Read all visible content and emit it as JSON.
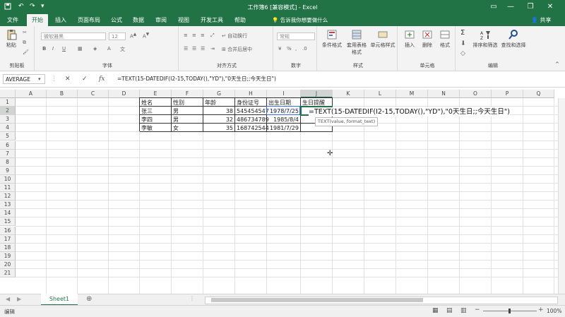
{
  "app": {
    "title": "工作簿6 [兼容模式] - Excel"
  },
  "tabs": [
    {
      "label": "文件"
    },
    {
      "label": "开始"
    },
    {
      "label": "插入"
    },
    {
      "label": "页面布局"
    },
    {
      "label": "公式"
    },
    {
      "label": "数据"
    },
    {
      "label": "审阅"
    },
    {
      "label": "视图"
    },
    {
      "label": "开发工具"
    },
    {
      "label": "帮助"
    }
  ],
  "tell_me": "告诉我你想要做什么",
  "share": "共享",
  "ribbon": {
    "clipboard": {
      "paste": "粘贴",
      "label": "剪贴板"
    },
    "font": {
      "name": "微软雅黑",
      "size": "12",
      "label": "字体"
    },
    "alignment": {
      "wrap": "自动换行",
      "merge": "合并后居中",
      "label": "对齐方式"
    },
    "number": {
      "format": "常规",
      "label": "数字"
    },
    "styles": {
      "conditional": "条件格式",
      "table": "套用表格格式",
      "cell": "单元格样式",
      "label": "样式"
    },
    "cells": {
      "insert": "插入",
      "delete": "删除",
      "format": "格式",
      "label": "单元格"
    },
    "editing": {
      "sort": "排序和筛选",
      "find": "查找和选择",
      "label": "编辑"
    }
  },
  "formula_bar": {
    "name_box": "AVERAGE",
    "formula": "=TEXT(15-DATEDIF(I2-15,TODAY(),\"YD\"),\"0天生日;;今天生日\")"
  },
  "columns": [
    "A",
    "B",
    "C",
    "D",
    "E",
    "F",
    "G",
    "H",
    "I",
    "J",
    "K",
    "L",
    "M",
    "N",
    "O",
    "P",
    "Q"
  ],
  "rows": [
    "1",
    "2",
    "3",
    "4",
    "5",
    "6",
    "7",
    "8",
    "9",
    "10",
    "11",
    "12",
    "13",
    "14",
    "15",
    "16",
    "17",
    "18",
    "19",
    "20",
    "21"
  ],
  "table": {
    "headers": [
      "姓名",
      "性别",
      "年龄",
      "身份证号",
      "出生日期",
      "生日提醒"
    ],
    "rows": [
      [
        "张三",
        "男",
        "38",
        "545454547",
        "1978/7/25",
        ""
      ],
      [
        "李四",
        "男",
        "32",
        "486734789",
        "1985/8/4",
        ""
      ],
      [
        "李敏",
        "女",
        "35",
        "168742544",
        "1981/7/29",
        ""
      ]
    ]
  },
  "edit_text": "=TEXT(15-DATEDIF(I2-15,TODAY(),\"YD\"),\"0天生日;;今天生日\")",
  "tooltip": "TEXT(value, format_text)",
  "sheet_tab": "Sheet1",
  "status": {
    "mode": "编辑",
    "zoom": "100%"
  },
  "colors": {
    "accent": "#217346"
  }
}
